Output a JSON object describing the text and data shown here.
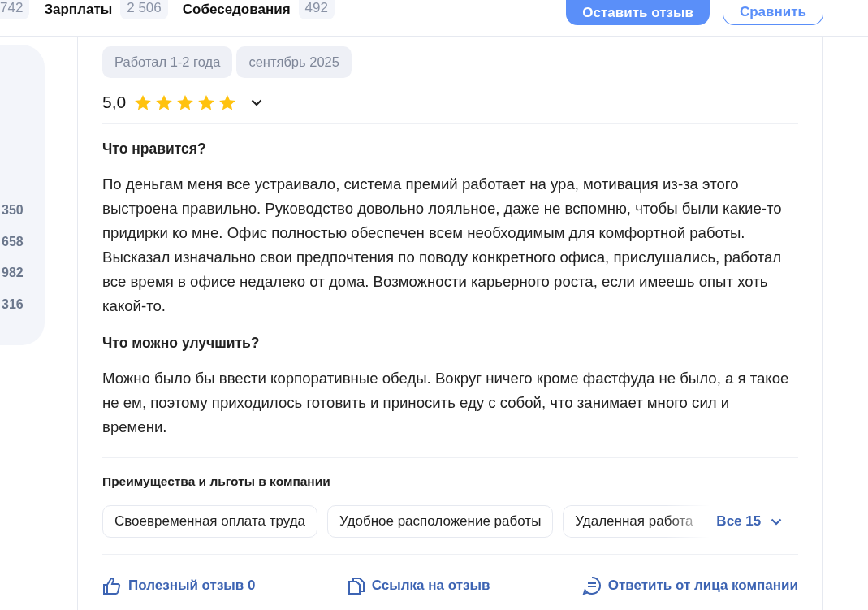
{
  "top_nav": {
    "items": [
      {
        "count": "742"
      },
      {
        "label": "Зарплаты",
        "count": "2 506"
      },
      {
        "label": "Собеседования",
        "count": "492"
      }
    ],
    "buttons": [
      {
        "kind": "primary",
        "label": "Оставить отзыв"
      },
      {
        "kind": "outline",
        "label": "Сравнить"
      }
    ]
  },
  "sidebar": {
    "counts": [
      "350",
      "658",
      "982",
      "316"
    ]
  },
  "review": {
    "tags": [
      "Работал 1-2 года",
      "сентябрь 2025"
    ],
    "rating": "5,0",
    "stars": 5,
    "sections": [
      {
        "title": "Что нравится?",
        "text": "По деньгам меня все устраивало, система премий работает на ура, мотивация из-за этого выстроена правильно. Руководство довольно лояльное, даже не вспомню, чтобы были какие-то придирки ко мне. Офис полностью обеспечен всем необходимым для комфортной работы. Высказал изначально свои предпочтения по поводу конкретного офиса, прислушались, работал все время в офисе недалеко от дома. Возможности карьерного роста, если имеешь опыт хоть какой-то."
      },
      {
        "title": "Что можно улучшить?",
        "text": "Можно было бы ввести корпоративные обеды. Вокруг ничего кроме фастфуда не было, а я такое не ем, поэтому приходилось готовить и приносить еду с собой, что занимает много сил и времени."
      }
    ],
    "benefits": {
      "title": "Преимущества и льготы в компании",
      "items": [
        "Своевременная оплата труда",
        "Удобное расположение работы",
        "Удаленная работа"
      ],
      "more": "Все 15"
    },
    "actions": [
      {
        "kind": "like",
        "label": "Полезный отзыв 0"
      },
      {
        "kind": "link",
        "label": "Ссылка на отзыв"
      },
      {
        "kind": "reply",
        "label": "Ответить от лица компании"
      }
    ]
  }
}
